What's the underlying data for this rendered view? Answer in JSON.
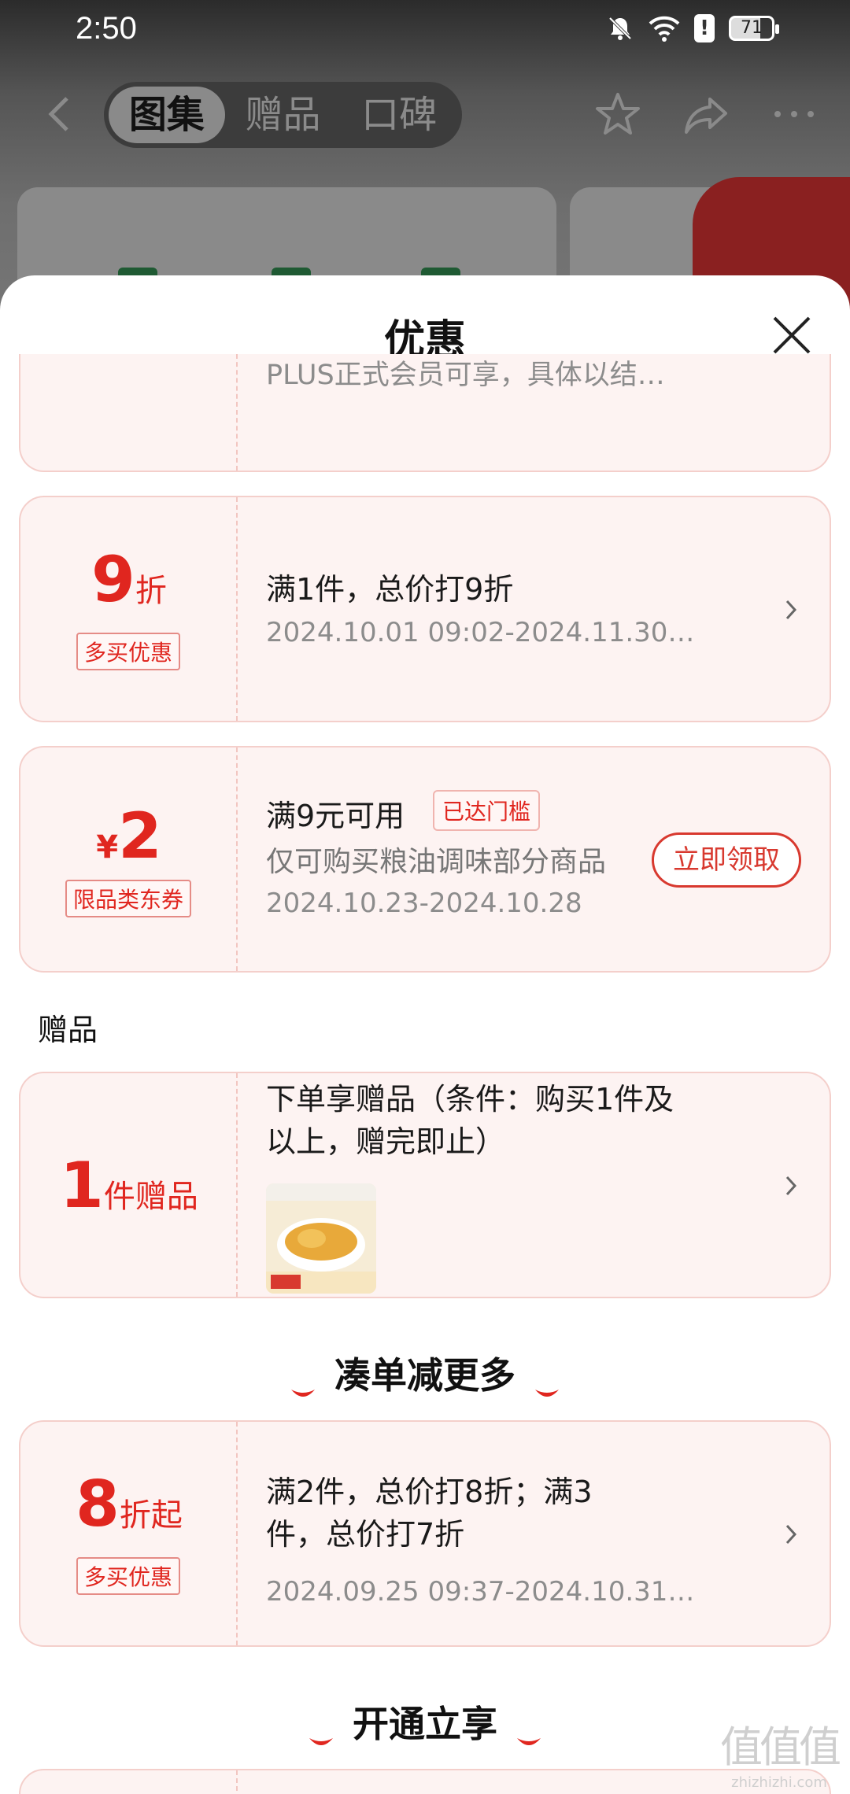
{
  "status_bar": {
    "time": "2:50",
    "battery": "71"
  },
  "nav": {
    "tabs": [
      "图集",
      "赠品",
      "口碑"
    ],
    "active_tab": 0
  },
  "sheet": {
    "title": "优惠"
  },
  "coupons": [
    {
      "desc": "PLUS正式会员可享，具体以结…"
    },
    {
      "big_number": "9",
      "big_unit": "折",
      "tag": "多买优惠",
      "title": "满1件，总价打9折",
      "date": "2024.10.01 09:02-2024.11.30…"
    },
    {
      "currency": "¥",
      "big_number": "2",
      "tag": "限品类东券",
      "title": "满9元可用",
      "threshold_tag": "已达门槛",
      "desc": "仅可购买粮油调味部分商品",
      "date": "2024.10.23-2024.10.28",
      "button": "立即领取"
    }
  ],
  "gift_section": {
    "label": "赠品",
    "card": {
      "big_number": "1",
      "big_unit": "件赠品",
      "title": "下单享赠品（条件：购买1件及以上，赠完即止）"
    }
  },
  "more_section": {
    "title": "凑单减更多",
    "card": {
      "big_number": "8",
      "big_unit": "折起",
      "tag": "多买优惠",
      "title": "满2件，总价打8折；满3件，总价打7折",
      "date": "2024.09.25 09:37-2024.10.31…"
    }
  },
  "open_section": {
    "title": "开通立享"
  },
  "watermark": {
    "line1": "值值值",
    "line2": "zhizhizhi.com"
  },
  "colors": {
    "accent": "#e0261f",
    "card_bg": "#fdf3f2",
    "card_border": "#f4cfcb"
  }
}
